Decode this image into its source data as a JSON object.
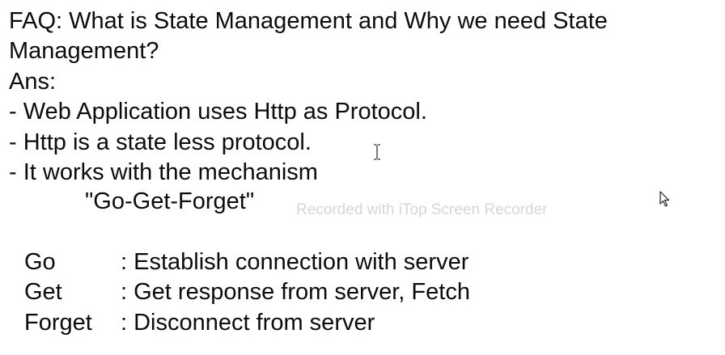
{
  "question": {
    "line1": "FAQ: What is State Management and Why we need State",
    "line2": "Management?"
  },
  "answer": {
    "label": "Ans:",
    "bullets": [
      "- Web Application uses Http as Protocol.",
      "- Http is a state less protocol.",
      "- It works with the mechanism"
    ],
    "mechanism": "\"Go-Get-Forget\""
  },
  "definitions": [
    {
      "term": "Go",
      "desc": ": Establish connection with server"
    },
    {
      "term": "Get",
      "desc": ":  Get response from server, Fetch"
    },
    {
      "term": "Forget",
      "desc": ": Disconnect from server"
    }
  ],
  "watermark": "Recorded with iTop Screen Recorder",
  "icons": {
    "text_cursor": "i-beam-cursor-icon",
    "mouse_pointer": "mouse-pointer-icon"
  }
}
